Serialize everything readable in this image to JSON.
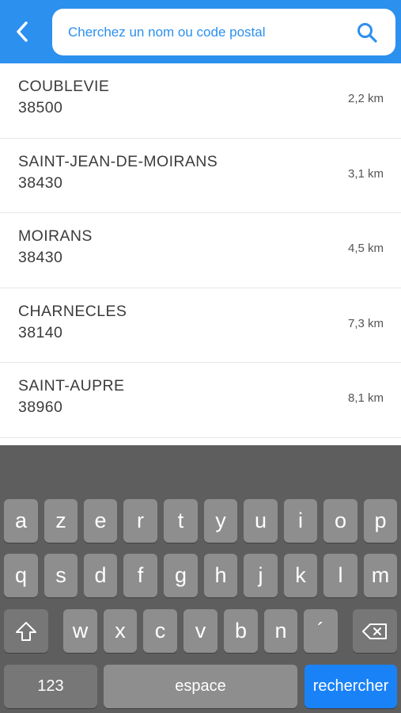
{
  "search": {
    "placeholder": "Cherchez un nom ou code postal"
  },
  "icons": {
    "back": "chevron-left-icon",
    "search": "search-icon",
    "shift": "shift-icon",
    "delete": "backspace-icon"
  },
  "colors": {
    "header": "#2c90ee",
    "accent_text": "#2c90ee",
    "keyboard_bg": "#5e5e5e",
    "key_bg": "#8e8e8e",
    "action_key": "#1a82f7"
  },
  "results": [
    {
      "name": "COUBLEVIE",
      "code": "38500",
      "distance": "2,2 km"
    },
    {
      "name": "SAINT-JEAN-DE-MOIRANS",
      "code": "38430",
      "distance": "3,1 km"
    },
    {
      "name": "MOIRANS",
      "code": "38430",
      "distance": "4,5 km"
    },
    {
      "name": "CHARNECLES",
      "code": "38140",
      "distance": "7,3 km"
    },
    {
      "name": "SAINT-AUPRE",
      "code": "38960",
      "distance": "8,1 km"
    }
  ],
  "keyboard": {
    "row1": [
      "a",
      "z",
      "e",
      "r",
      "t",
      "y",
      "u",
      "i",
      "o",
      "p"
    ],
    "row2": [
      "q",
      "s",
      "d",
      "f",
      "g",
      "h",
      "j",
      "k",
      "l",
      "m"
    ],
    "row3": [
      "w",
      "x",
      "c",
      "v",
      "b",
      "n",
      "´"
    ],
    "numbers_label": "123",
    "space_label": "espace",
    "action_label": "rechercher"
  }
}
